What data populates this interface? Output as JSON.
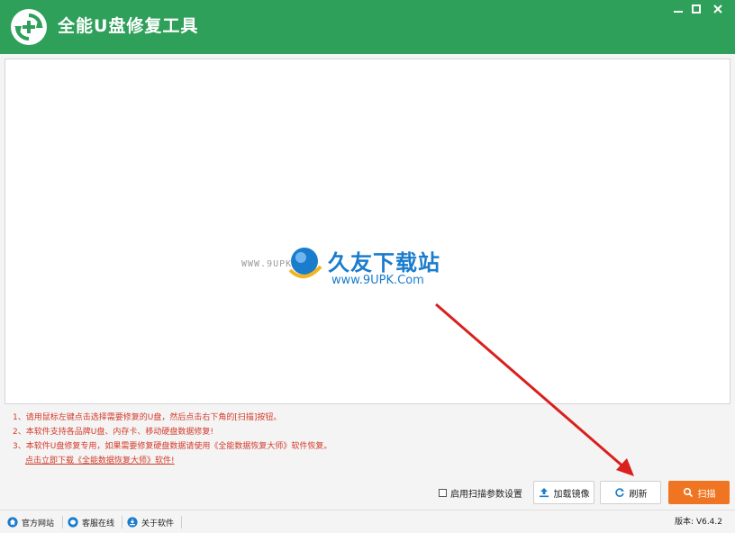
{
  "app": {
    "title": "全能U盘修复工具",
    "accent": "#2ea05a",
    "window_controls": [
      "minimize-icon",
      "maximize-icon",
      "close-icon"
    ]
  },
  "watermark": {
    "url_left": "WWW.9UPK.COM",
    "brand": "久友下载站",
    "url": "www.9UPK.Com"
  },
  "instructions": {
    "lines": [
      "1、请用鼠标左键点击选择需要修复的U盘，然后点击右下角的[扫描]按钮。",
      "2、本软件支持各品牌U盘、内存卡、移动硬盘数据修复!",
      "3、本软件U盘修复专用，如果需要修复硬盘数据请使用《全能数据恢复大师》软件恢复。"
    ],
    "download_link": "点击立即下载《全能数据恢复大师》软件!",
    "color": "#d33b2b"
  },
  "controls": {
    "scan_settings_label": "启用扫描参数设置",
    "scan_settings_checked": false,
    "load_image_label": "加载镜像",
    "refresh_label": "刷新",
    "scan_label": "扫描",
    "scan_color": "#f07523"
  },
  "footer": {
    "website": "官方网站",
    "support": "客服在线",
    "about": "关于软件",
    "version": "版本: V6.4.2"
  }
}
